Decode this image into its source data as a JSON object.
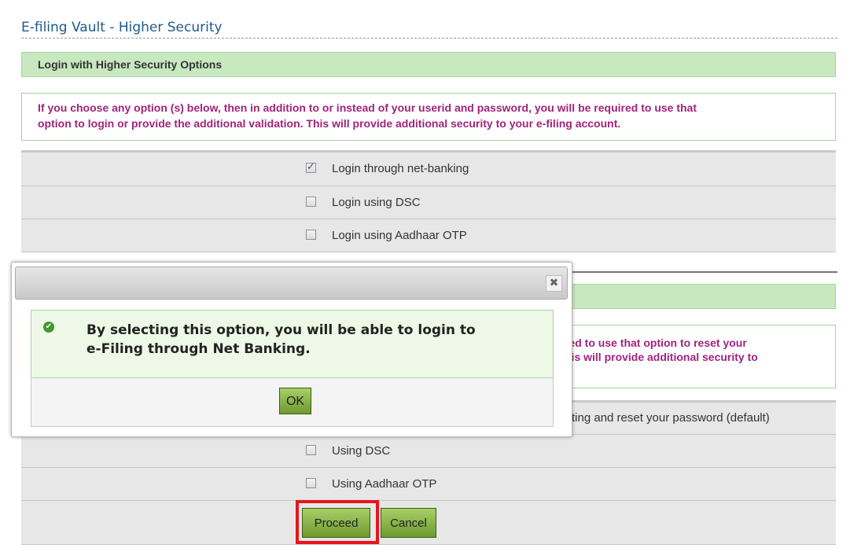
{
  "page_title": "E-filing Vault - Higher Security",
  "login_section": {
    "heading": "Login with Higher Security Options",
    "info_line1": "If you choose any option (s) below, then in addition to or instead of your userid and password, you will be required to use that",
    "info_line2": "option to login or provide the additional validation. This will provide additional security to your e-filing account.",
    "options": [
      {
        "label": "Login through net-banking",
        "checked": true
      },
      {
        "label": "Login using DSC",
        "checked": false
      },
      {
        "label": "Login using Aadhaar OTP",
        "checked": false
      }
    ]
  },
  "reset_section": {
    "info_line1_partial": "red to use that option to reset your",
    "info_line2_partial": "his will provide additional security to",
    "option_partial": "ting and reset your password (default)",
    "options": [
      {
        "label": "Using DSC",
        "checked": false
      },
      {
        "label": "Using Aadhaar OTP",
        "checked": false
      }
    ]
  },
  "buttons": {
    "proceed": "Proceed",
    "cancel": "Cancel"
  },
  "dialog": {
    "close_symbol": "✖",
    "ok_symbol": "✔",
    "message_line1": "By selecting this option, you will be able to login to",
    "message_line2": "e-Filing through Net Banking.",
    "ok_label": "OK"
  },
  "colors": {
    "section_green": "#c8e8c0",
    "info_text": "#a0237d",
    "button_green": "#8fbb4c",
    "highlight_red": "#e8141c"
  }
}
